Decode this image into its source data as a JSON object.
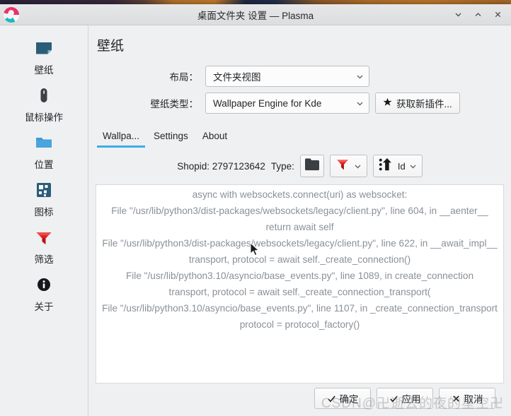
{
  "window": {
    "title": "桌面文件夹 设置 — Plasma",
    "app_icon": "plasma-logo-icon",
    "buttons": [
      {
        "name": "minimize-button",
        "icon": "chevron-down-icon"
      },
      {
        "name": "maximize-button",
        "icon": "chevron-up-icon"
      },
      {
        "name": "close-button",
        "icon": "close-x-icon"
      }
    ]
  },
  "sidebar": {
    "items": [
      {
        "label": "壁纸",
        "icon": "wallpaper-icon"
      },
      {
        "label": "鼠标操作",
        "icon": "mouse-icon"
      },
      {
        "label": "位置",
        "icon": "folder-icon"
      },
      {
        "label": "图标",
        "icon": "grid-icons-icon"
      },
      {
        "label": "筛选",
        "icon": "funnel-filter-icon"
      },
      {
        "label": "关于",
        "icon": "info-icon"
      }
    ]
  },
  "main": {
    "page_title": "壁纸",
    "form": {
      "layout_label": "布局：",
      "layout_value": "文件夹视图",
      "wallpaper_type_label": "壁纸类型：",
      "wallpaper_type_value": "Wallpaper Engine for Kde",
      "get_new_plugins_label": "获取新插件...",
      "get_new_plugins_icon": "star-icon"
    },
    "tabs": [
      {
        "label": "Wallpa...",
        "active": true
      },
      {
        "label": "Settings",
        "active": false
      },
      {
        "label": "About",
        "active": false
      }
    ],
    "toolbar": {
      "shopid_text": "Shopid: 2797123642",
      "type_label": "Type:",
      "type_button_icon": "folder-dark-icon",
      "filter_button_icon": "funnel-filter-icon",
      "sort_button_icon": "sort-ascending-icon",
      "sort_label": "Id"
    },
    "log_lines": [
      "async with websockets.connect(uri) as websocket:",
      "File \"/usr/lib/python3/dist-packages/websockets/legacy/client.py\", line 604, in __aenter__",
      "return await self",
      "File \"/usr/lib/python3/dist-packages/websockets/legacy/client.py\", line 622, in __await_impl__",
      "transport, protocol = await self._create_connection()",
      "File \"/usr/lib/python3.10/asyncio/base_events.py\", line 1089, in create_connection",
      "transport, protocol = await self._create_connection_transport(",
      "File \"/usr/lib/python3.10/asyncio/base_events.py\", line 1107, in _create_connection_transport",
      "protocol = protocol_factory()"
    ]
  },
  "footer": {
    "buttons": [
      {
        "label": "确定",
        "icon": "check-icon",
        "name": "ok-button"
      },
      {
        "label": "应用",
        "icon": "check-icon",
        "name": "apply-button"
      },
      {
        "label": "取消",
        "icon": "close-x-icon",
        "name": "cancel-button"
      }
    ]
  },
  "watermark": "CSDN@卍逝去的夜的星空卍",
  "colors": {
    "accent": "#3daee9",
    "window_bg": "#eff0f1",
    "text": "#232629",
    "log_text": "#8a9097",
    "filter_red": "#e02020"
  }
}
